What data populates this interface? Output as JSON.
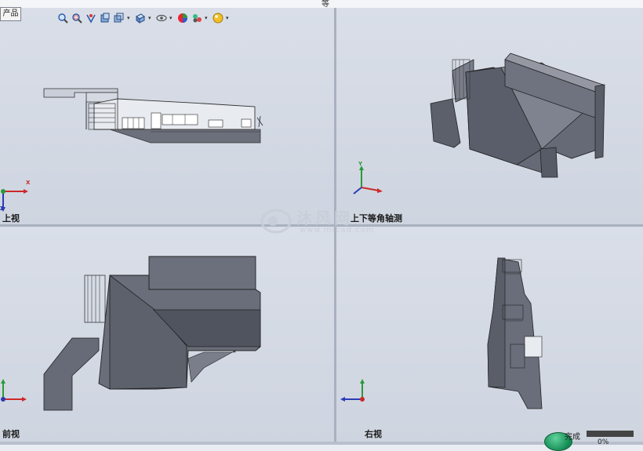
{
  "window": {
    "title_fragment": "等"
  },
  "tab": {
    "label": "产品"
  },
  "toolbar": {
    "icons": [
      "zoom-to-fit-icon",
      "zoom-to-area-icon",
      "previous-view-icon",
      "section-view-icon",
      "view-orientation-icon",
      "display-style-icon",
      "hide-show-items-icon",
      "edit-appearance-icon",
      "apply-scene-icon",
      "view-settings-icon"
    ]
  },
  "viewports": {
    "top_left": {
      "label": "上视"
    },
    "top_right": {
      "label": "上下等角轴测"
    },
    "bottom_left": {
      "label": "前视"
    },
    "bottom_right": {
      "label": "右视"
    }
  },
  "triad": {
    "x": "X",
    "y": "Y",
    "z": "Z"
  },
  "watermark": {
    "text": "沐风网",
    "url": "www.mfcad.com"
  },
  "status": {
    "label": "完成",
    "percent": "0%"
  },
  "colors": {
    "background": "#d3d9e3",
    "model_fill": "#6b6f7c",
    "model_dark": "#4f535e",
    "axis_x": "#cc2a2a",
    "axis_y": "#2b9a3a",
    "axis_z": "#2b3bb5"
  }
}
